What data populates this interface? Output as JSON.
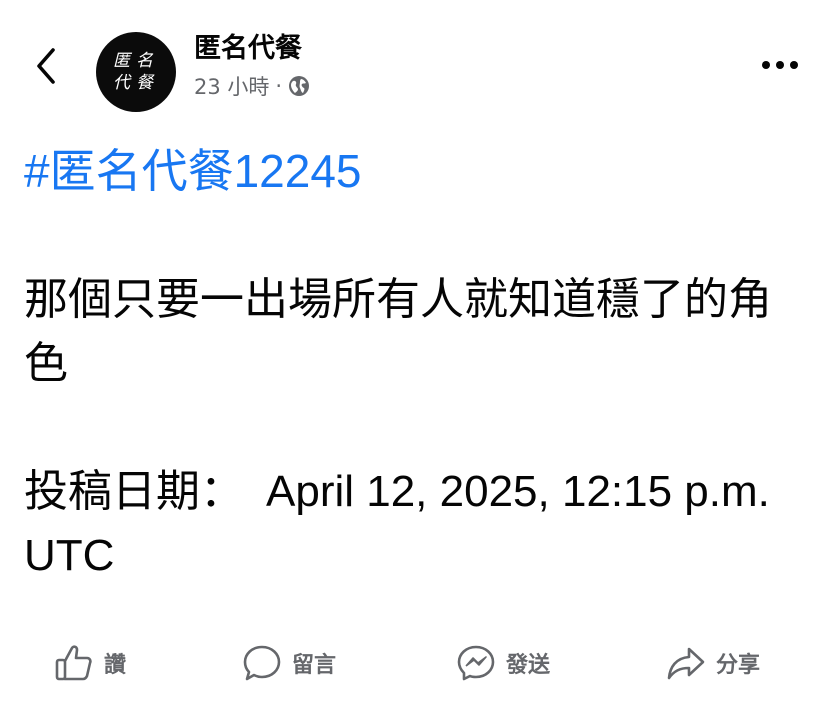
{
  "header": {
    "back_icon": "chevron-left-icon",
    "avatar_text": "匿名代餐",
    "page_name": "匿名代餐",
    "time": "23 小時",
    "separator": "·",
    "privacy_icon": "globe-icon",
    "more_icon": "more-horizontal-icon"
  },
  "post": {
    "hashtag": "#匿名代餐12245",
    "line1": "那個只要一出場所有人就知道穩了的角色",
    "line2": "投稿日期：　April 12, 2025, 12:15 p.m. UTC"
  },
  "actions": {
    "like": {
      "label": "讚",
      "icon": "thumbs-up-icon"
    },
    "comment": {
      "label": "留言",
      "icon": "comment-bubble-icon"
    },
    "send": {
      "label": "發送",
      "icon": "messenger-icon"
    },
    "share": {
      "label": "分享",
      "icon": "share-arrow-icon"
    }
  },
  "colors": {
    "accent": "#1877f2",
    "text": "#050505",
    "secondary": "#65676b"
  }
}
